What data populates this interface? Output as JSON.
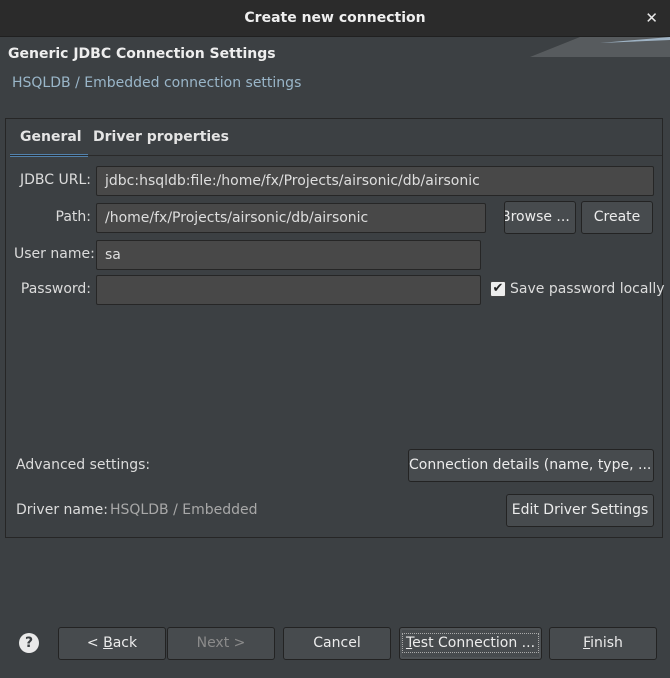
{
  "window": {
    "title": "Create new connection",
    "close_glyph": "✕"
  },
  "header": {
    "title": "Generic JDBC Connection Settings",
    "subtitle": "HSQLDB / Embedded connection settings"
  },
  "tabs": [
    {
      "label": "General",
      "active": true
    },
    {
      "label": "Driver properties",
      "active": false
    }
  ],
  "form": {
    "jdbc_url": {
      "label": "JDBC URL:",
      "value": "jdbc:hsqldb:file:/home/fx/Projects/airsonic/db/airsonic"
    },
    "path": {
      "label": "Path:",
      "value": "/home/fx/Projects/airsonic/db/airsonic"
    },
    "browse_label": "Browse ...",
    "create_label": "Create",
    "user": {
      "label": "User name:",
      "value": "sa"
    },
    "password": {
      "label": "Password:",
      "value": ""
    },
    "save_password": {
      "label": "Save password locally",
      "checked": true,
      "check_glyph": "✔"
    },
    "advanced_label": "Advanced settings:",
    "connection_details_label": "Connection details (name, type, ... )",
    "driver_name_label": "Driver name:",
    "driver_name_value": "HSQLDB / Embedded",
    "edit_driver_label": "Edit Driver Settings"
  },
  "footer": {
    "help_glyph": "?",
    "back": {
      "prefix": "< ",
      "mnemonic": "B",
      "rest": "ack"
    },
    "next_label": "Next >",
    "cancel_label": "Cancel",
    "test": {
      "mnemonic": "T",
      "rest": "est Connection ..."
    },
    "finish": {
      "mnemonic": "F",
      "rest": "inish"
    }
  },
  "colors": {
    "background": "#3c4043",
    "tab_accent": "#5282ad",
    "subtitle": "#9ab6c9"
  }
}
